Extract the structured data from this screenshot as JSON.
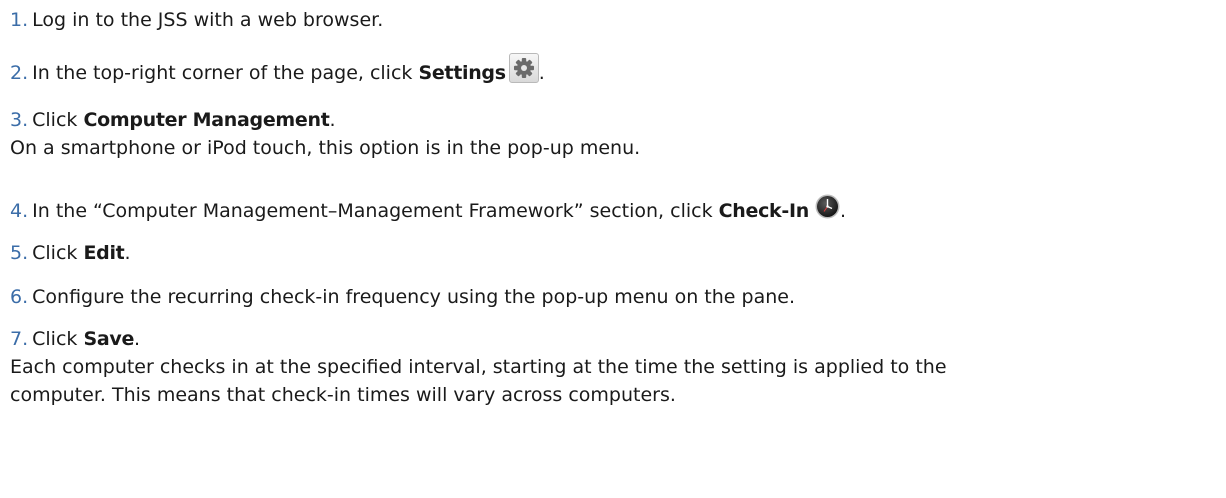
{
  "steps": [
    {
      "num": "1.",
      "text": "Log in to the JSS with a web browser."
    },
    {
      "num": "2.",
      "pre": "In the top-right corner of the page, click ",
      "keyword": "Settings",
      "post": ".",
      "icon": "gear-icon"
    },
    {
      "num": "3.",
      "pre": "Click ",
      "keyword": "Computer Management",
      "post": ".",
      "desc": "On a smartphone or iPod touch, this option is in the pop-up menu."
    },
    {
      "num": "4.",
      "pre": "In the “Computer Management–Management Framework” section, click ",
      "keyword": "Check-In",
      "post": ".",
      "icon": "clock-icon"
    },
    {
      "num": "5.",
      "pre": "Click ",
      "keyword": "Edit",
      "post": "."
    },
    {
      "num": "6.",
      "text": "Configure the recurring check-in frequency using the pop-up menu on the pane."
    },
    {
      "num": "7.",
      "pre": "Click ",
      "keyword": "Save",
      "post": ".",
      "desc": "Each computer checks in at the specified interval, starting at the time the setting is applied to the",
      "desc2": "computer. This means that check-in times will vary across computers."
    }
  ],
  "colors": {
    "number": "#3b6da8",
    "text": "#1a1a1a"
  }
}
